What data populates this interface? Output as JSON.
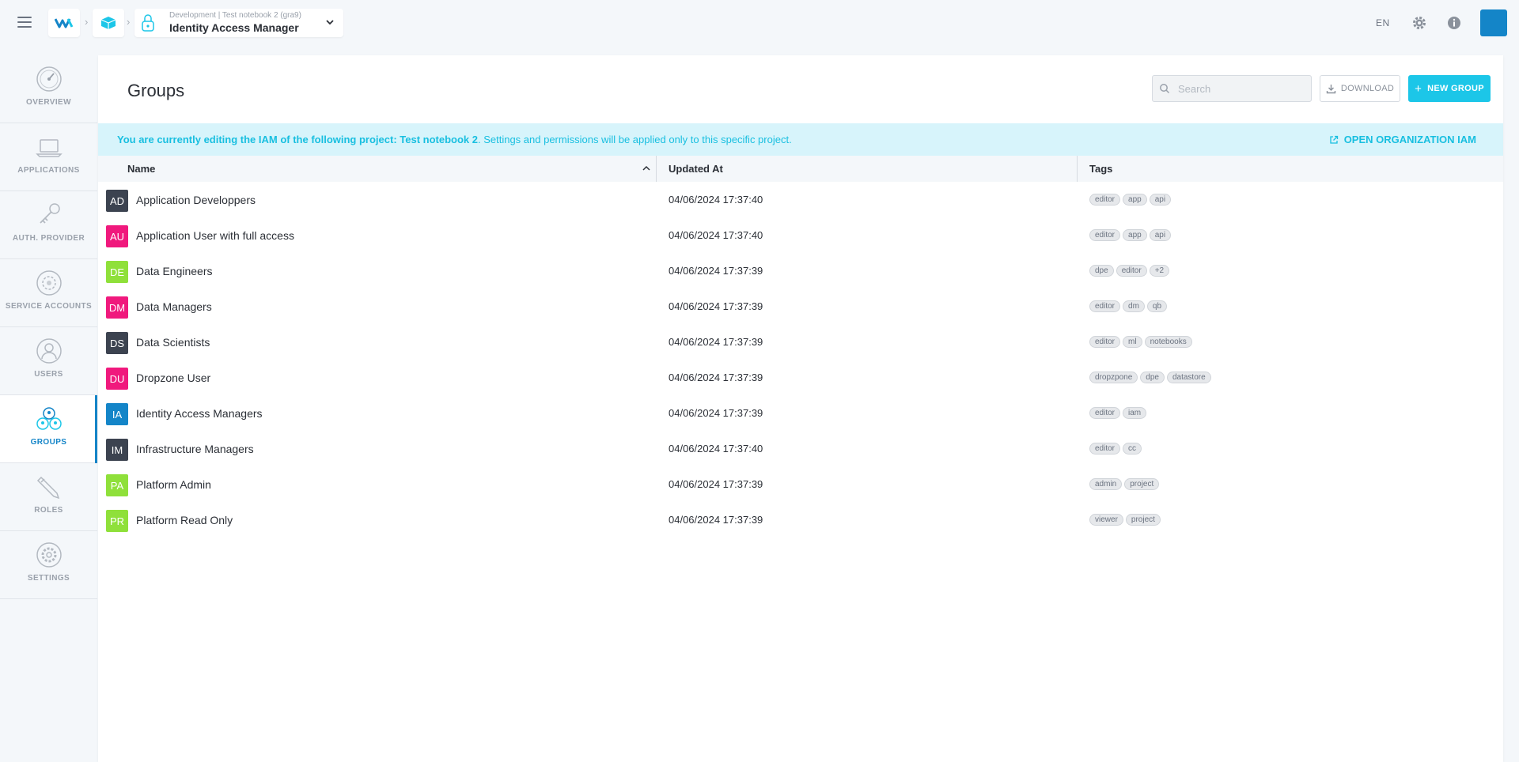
{
  "header": {
    "breadcrumb_sub": "Development | Test notebook 2 (gra9)",
    "breadcrumb_title": "Identity Access Manager",
    "language": "EN"
  },
  "sidebar": {
    "items": [
      {
        "label": "OVERVIEW",
        "icon": "gauge-icon"
      },
      {
        "label": "APPLICATIONS",
        "icon": "laptop-icon"
      },
      {
        "label": "AUTH. PROVIDER",
        "icon": "key-icon"
      },
      {
        "label": "SERVICE ACCOUNTS",
        "icon": "service-account-icon"
      },
      {
        "label": "USERS",
        "icon": "user-icon"
      },
      {
        "label": "GROUPS",
        "icon": "group-icon",
        "active": true
      },
      {
        "label": "ROLES",
        "icon": "pencil-icon"
      },
      {
        "label": "SETTINGS",
        "icon": "settings-gear-icon"
      }
    ]
  },
  "page": {
    "title": "Groups",
    "search_placeholder": "Search",
    "download_label": "DOWNLOAD",
    "new_group_label": "NEW GROUP"
  },
  "banner": {
    "bold_text": "You are currently editing the IAM of the following project: Test notebook 2",
    "rest_text": ". Settings and permissions will be applied only to this specific project.",
    "link_label": "OPEN ORGANIZATION IAM"
  },
  "table": {
    "columns": [
      "Name",
      "Updated At",
      "Tags"
    ],
    "rows": [
      {
        "initials": "AD",
        "color": "#3c4350",
        "name": "Application Developpers",
        "updated": "04/06/2024 17:37:40",
        "tags": [
          "editor",
          "app",
          "api"
        ]
      },
      {
        "initials": "AU",
        "color": "#f0197d",
        "name": "Application User with full access",
        "updated": "04/06/2024 17:37:40",
        "tags": [
          "editor",
          "app",
          "api"
        ]
      },
      {
        "initials": "DE",
        "color": "#8fe03a",
        "name": "Data Engineers",
        "updated": "04/06/2024 17:37:39",
        "tags": [
          "dpe",
          "editor",
          "+2"
        ]
      },
      {
        "initials": "DM",
        "color": "#f0197d",
        "name": "Data Managers",
        "updated": "04/06/2024 17:37:39",
        "tags": [
          "editor",
          "dm",
          "qb"
        ]
      },
      {
        "initials": "DS",
        "color": "#3c4350",
        "name": "Data Scientists",
        "updated": "04/06/2024 17:37:39",
        "tags": [
          "editor",
          "ml",
          "notebooks"
        ]
      },
      {
        "initials": "DU",
        "color": "#f0197d",
        "name": "Dropzone User",
        "updated": "04/06/2024 17:37:39",
        "tags": [
          "dropzpone",
          "dpe",
          "datastore"
        ]
      },
      {
        "initials": "IA",
        "color": "#1485c8",
        "name": "Identity Access Managers",
        "updated": "04/06/2024 17:37:39",
        "tags": [
          "editor",
          "iam"
        ]
      },
      {
        "initials": "IM",
        "color": "#3c4350",
        "name": "Infrastructure Managers",
        "updated": "04/06/2024 17:37:40",
        "tags": [
          "editor",
          "cc"
        ]
      },
      {
        "initials": "PA",
        "color": "#8fe03a",
        "name": "Platform Admin",
        "updated": "04/06/2024 17:37:39",
        "tags": [
          "admin",
          "project"
        ]
      },
      {
        "initials": "PR",
        "color": "#8fe03a",
        "name": "Platform Read Only",
        "updated": "04/06/2024 17:37:39",
        "tags": [
          "viewer",
          "project"
        ]
      }
    ]
  }
}
